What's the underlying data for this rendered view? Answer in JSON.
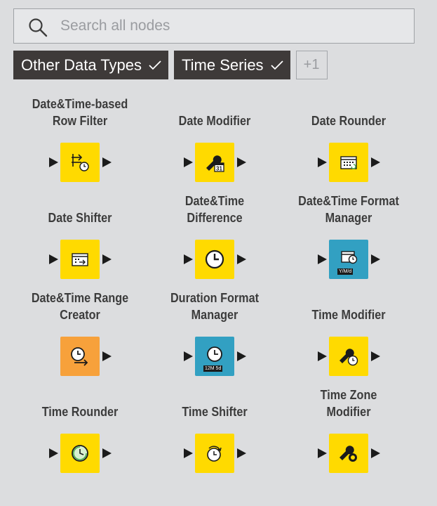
{
  "search": {
    "placeholder": "Search all nodes",
    "value": ""
  },
  "tags": [
    {
      "label": "Other Data Types"
    },
    {
      "label": "Time Series"
    }
  ],
  "more_tags_label": "+1",
  "colors": {
    "yellow": "#ffda00",
    "orange": "#f7a13b",
    "teal": "#32a0c2",
    "tag_bg": "#3e3a39",
    "background": "#dcdddf"
  },
  "nodes": [
    {
      "label_lines": [
        "Date&Time-based",
        "Row Filter"
      ],
      "color": "yellow",
      "icon": "row-filter-clock-icon",
      "in_port": true
    },
    {
      "label_lines": [
        "Date Modifier"
      ],
      "color": "yellow",
      "icon": "wrench-calendar-icon",
      "in_port": true
    },
    {
      "label_lines": [
        "Date Rounder"
      ],
      "color": "yellow",
      "icon": "calendar-rounder-icon",
      "in_port": true
    },
    {
      "label_lines": [
        "Date Shifter"
      ],
      "color": "yellow",
      "icon": "calendar-shift-icon",
      "in_port": true
    },
    {
      "label_lines": [
        "Date&Time",
        "Difference"
      ],
      "color": "yellow",
      "icon": "clock-icon",
      "in_port": true
    },
    {
      "label_lines": [
        "Date&Time Format",
        "Manager"
      ],
      "color": "teal",
      "icon": "calendar-format-icon",
      "badge": "Y/M/d",
      "in_port": true
    },
    {
      "label_lines": [
        "Date&Time Range",
        "Creator"
      ],
      "color": "orange",
      "icon": "clock-arrow-icon",
      "in_port": false
    },
    {
      "label_lines": [
        "Duration Format",
        "Manager"
      ],
      "color": "teal",
      "icon": "clock-format-icon",
      "badge": "12M 5d",
      "in_port": true
    },
    {
      "label_lines": [
        "Time Modifier"
      ],
      "color": "yellow",
      "icon": "wrench-clock-icon",
      "in_port": true
    },
    {
      "label_lines": [
        "Time Rounder"
      ],
      "color": "yellow",
      "icon": "clock-rounder-icon",
      "in_port": true
    },
    {
      "label_lines": [
        "Time Shifter"
      ],
      "color": "yellow",
      "icon": "clock-shift-icon",
      "in_port": true
    },
    {
      "label_lines": [
        "Time Zone",
        "Modifier"
      ],
      "color": "yellow",
      "icon": "wrench-zone-icon",
      "in_port": true
    }
  ]
}
